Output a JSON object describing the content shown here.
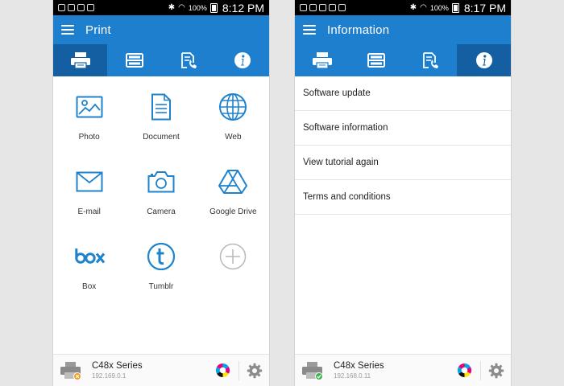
{
  "left": {
    "status": {
      "battery": "100%",
      "time": "8:12 PM"
    },
    "title": "Print",
    "tiles": [
      {
        "label": "Photo",
        "icon": "photo-icon"
      },
      {
        "label": "Document",
        "icon": "document-icon"
      },
      {
        "label": "Web",
        "icon": "globe-icon"
      },
      {
        "label": "E-mail",
        "icon": "envelope-icon"
      },
      {
        "label": "Camera",
        "icon": "camera-icon"
      },
      {
        "label": "Google Drive",
        "icon": "google-drive-icon"
      },
      {
        "label": "Box",
        "icon": "box-logo-icon"
      },
      {
        "label": "Tumblr",
        "icon": "tumblr-icon"
      },
      {
        "label": "",
        "icon": "add-icon"
      }
    ],
    "printer": {
      "name": "C48x Series",
      "ip": "192.169.0.1",
      "status": "warning"
    }
  },
  "right": {
    "status": {
      "battery": "100%",
      "time": "8:17 PM"
    },
    "title": "Information",
    "items": [
      "Software update",
      "Software information",
      "View tutorial again",
      "Terms and conditions"
    ],
    "printer": {
      "name": "C48x Series",
      "ip": "192.168.0.11",
      "status": "ok"
    }
  },
  "tabs": [
    "print-tab",
    "scan-tab",
    "fax-tab",
    "info-tab"
  ],
  "colors": {
    "primary": "#1e7fcf",
    "active_tab": "#135fa1",
    "icon_blue": "#1f82cc",
    "ok": "#3fb34f",
    "warning": "#f39c24"
  }
}
